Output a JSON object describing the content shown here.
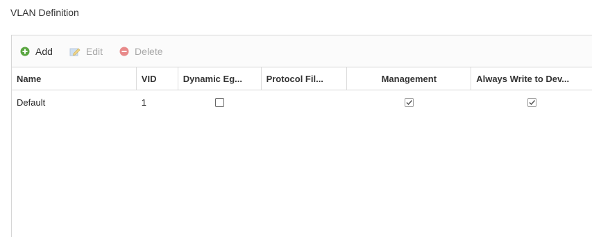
{
  "section": {
    "title": "VLAN Definition"
  },
  "toolbar": {
    "add_label": "Add",
    "edit_label": "Edit",
    "delete_label": "Delete",
    "add_icon": "plus-circle-icon",
    "edit_icon": "edit-pencil-icon",
    "delete_icon": "minus-circle-icon",
    "add_color": "#5aa641",
    "delete_color": "#e06a6a"
  },
  "table": {
    "columns": [
      "Name",
      "VID",
      "Dynamic Eg...",
      "Protocol Fil...",
      "Management",
      "Always Write to Dev..."
    ],
    "rows": [
      {
        "name": "Default",
        "vid": "1",
        "dynamic_egress": false,
        "protocol_filter": "",
        "management": true,
        "always_write": true
      }
    ]
  }
}
